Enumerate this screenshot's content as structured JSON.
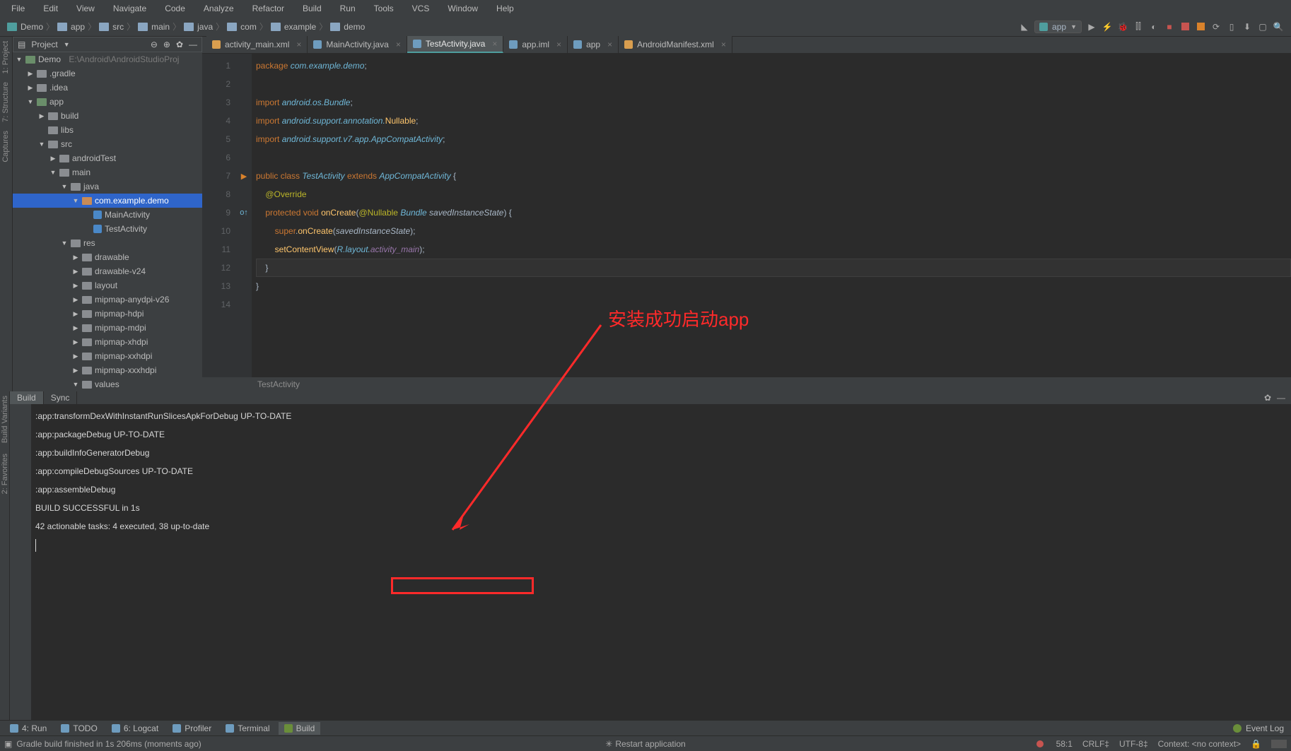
{
  "menu": [
    "File",
    "Edit",
    "View",
    "Navigate",
    "Code",
    "Analyze",
    "Refactor",
    "Build",
    "Run",
    "Tools",
    "VCS",
    "Window",
    "Help"
  ],
  "breadcrumbs": [
    "Demo",
    "app",
    "src",
    "main",
    "java",
    "com",
    "example",
    "demo"
  ],
  "run_config": {
    "label": "app"
  },
  "project_panel": {
    "title": "Project"
  },
  "left_stripe": [
    "1: Project",
    "7: Structure",
    "Captures"
  ],
  "tree": {
    "root": "Demo",
    "root_path": "E:\\Android\\AndroidStudioProj",
    "nodes": [
      {
        "indent": 1,
        "tw": "▶",
        "icon": "fold",
        "name": ".gradle"
      },
      {
        "indent": 1,
        "tw": "▶",
        "icon": "fold",
        "name": ".idea"
      },
      {
        "indent": 1,
        "tw": "▼",
        "icon": "fold module",
        "name": "app"
      },
      {
        "indent": 2,
        "tw": "▶",
        "icon": "fold",
        "name": "build"
      },
      {
        "indent": 2,
        "tw": "",
        "icon": "fold",
        "name": "libs"
      },
      {
        "indent": 2,
        "tw": "▼",
        "icon": "fold",
        "name": "src"
      },
      {
        "indent": 3,
        "tw": "▶",
        "icon": "fold",
        "name": "androidTest"
      },
      {
        "indent": 3,
        "tw": "▼",
        "icon": "fold",
        "name": "main"
      },
      {
        "indent": 4,
        "tw": "▼",
        "icon": "fold",
        "name": "java"
      },
      {
        "indent": 5,
        "tw": "▼",
        "icon": "fold package",
        "name": "com.example.demo",
        "sel": true
      },
      {
        "indent": 6,
        "tw": "",
        "icon": "file-ic",
        "name": "MainActivity"
      },
      {
        "indent": 6,
        "tw": "",
        "icon": "file-ic",
        "name": "TestActivity"
      },
      {
        "indent": 4,
        "tw": "▼",
        "icon": "fold",
        "name": "res"
      },
      {
        "indent": 5,
        "tw": "▶",
        "icon": "fold",
        "name": "drawable"
      },
      {
        "indent": 5,
        "tw": "▶",
        "icon": "fold",
        "name": "drawable-v24"
      },
      {
        "indent": 5,
        "tw": "▶",
        "icon": "fold",
        "name": "layout"
      },
      {
        "indent": 5,
        "tw": "▶",
        "icon": "fold",
        "name": "mipmap-anydpi-v26"
      },
      {
        "indent": 5,
        "tw": "▶",
        "icon": "fold",
        "name": "mipmap-hdpi"
      },
      {
        "indent": 5,
        "tw": "▶",
        "icon": "fold",
        "name": "mipmap-mdpi"
      },
      {
        "indent": 5,
        "tw": "▶",
        "icon": "fold",
        "name": "mipmap-xhdpi"
      },
      {
        "indent": 5,
        "tw": "▶",
        "icon": "fold",
        "name": "mipmap-xxhdpi"
      },
      {
        "indent": 5,
        "tw": "▶",
        "icon": "fold",
        "name": "mipmap-xxxhdpi"
      },
      {
        "indent": 5,
        "tw": "▼",
        "icon": "fold",
        "name": "values"
      }
    ]
  },
  "tabs": [
    {
      "icon": "xml",
      "label": "activity_main.xml",
      "active": false
    },
    {
      "icon": "ic",
      "label": "MainActivity.java",
      "active": false
    },
    {
      "icon": "ic",
      "label": "TestActivity.java",
      "active": true
    },
    {
      "icon": "ic",
      "label": "app.iml",
      "active": false
    },
    {
      "icon": "ic",
      "label": "app",
      "active": false
    },
    {
      "icon": "xml",
      "label": "AndroidManifest.xml",
      "active": false
    }
  ],
  "code_lines": [
    "1",
    "2",
    "3",
    "4",
    "5",
    "6",
    "7",
    "8",
    "9",
    "10",
    "11",
    "12",
    "13",
    "14"
  ],
  "editor_breadcrumb": "TestActivity",
  "code": {
    "l1": {
      "kw": "package ",
      "pkg": "com.example.demo",
      "sc": ";"
    },
    "l3": {
      "kw": "import ",
      "pkg": "android.os.Bundle",
      "sc": ";"
    },
    "l4": {
      "kw": "import ",
      "pkg": "android.support.annotation.",
      "cls": "Nullable",
      "sc": ";"
    },
    "l5": {
      "kw": "import ",
      "pkg": "android.support.v7.app.AppCompatActivity",
      "sc": ";"
    },
    "l7": {
      "kw1": "public class ",
      "cls": "TestActivity",
      "kw2": " extends ",
      "base": "AppCompatActivity",
      "br": " {"
    },
    "l8": {
      "ann": "@Override"
    },
    "l9": {
      "kw": "protected void ",
      "fn": "onCreate",
      "p1": "(",
      "ann": "@Nullable",
      "sp": " ",
      "type": "Bundle",
      "sp2": " ",
      "param": "savedInstanceState",
      "p2": ") {"
    },
    "l10": {
      "kw": "super",
      "dot": ".",
      "fn": "onCreate",
      "p1": "(",
      "param": "savedInstanceState",
      "p2": ");"
    },
    "l11": {
      "fn": "setContentView",
      "p1": "(",
      "r": "R.layout.",
      "it": "activity_main",
      "p2": ");"
    },
    "l12": {
      "br": "}"
    },
    "l13": {
      "br": "}"
    }
  },
  "build": {
    "tabs": [
      "Build",
      "Sync"
    ],
    "active_tab": "Build",
    "lines": [
      ":app:transformDexWithInstantRunSlicesApkForDebug UP-TO-DATE",
      ":app:packageDebug UP-TO-DATE",
      ":app:buildInfoGeneratorDebug",
      ":app:compileDebugSources UP-TO-DATE",
      ":app:assembleDebug",
      "",
      "BUILD SUCCESSFUL in 1s",
      "42 actionable tasks: 4 executed, 38 up-to-date"
    ]
  },
  "left_stripe_bottom": [
    "Build Variants",
    "2: Favorites"
  ],
  "bottom_tools": [
    {
      "label": "4: Run"
    },
    {
      "label": "TODO"
    },
    {
      "label": "6: Logcat"
    },
    {
      "label": "Profiler"
    },
    {
      "label": "Terminal"
    },
    {
      "label": "Build",
      "active": true
    }
  ],
  "bottom_right": "Event Log",
  "status": {
    "left": "Gradle build finished in 1s 206ms (moments ago)",
    "center": "Restart application",
    "right": [
      "58:1",
      "CRLF‡",
      "UTF-8‡",
      "Context: <no context>"
    ]
  },
  "annotation": "安装成功启动app"
}
